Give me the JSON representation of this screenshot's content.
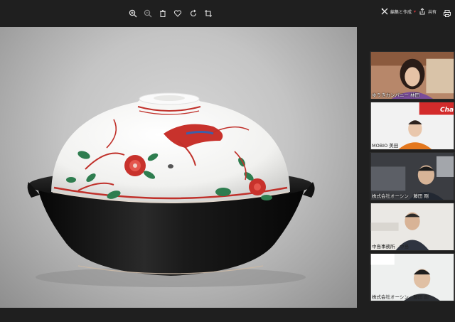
{
  "toolbar": {
    "icons": [
      "zoom-in-icon",
      "zoom-out-icon",
      "trash-icon",
      "heart-icon",
      "rotate-icon",
      "crop-icon"
    ],
    "edit_create_label": "編集と作成",
    "share_label": "共有"
  },
  "gallery": {
    "tiles": [
      {
        "name": "ゆうきカンパニー 林田"
      },
      {
        "name": "MOBIO 美田",
        "sign": "Cha"
      },
      {
        "name": "株式会社オーシン　藤田 剛"
      },
      {
        "name": "中島事務所　中島"
      },
      {
        "name": "株式会社オーシン　藤田 創"
      }
    ]
  },
  "colors": {
    "background": "#1f1f1f",
    "accent_red": "#d13438"
  }
}
